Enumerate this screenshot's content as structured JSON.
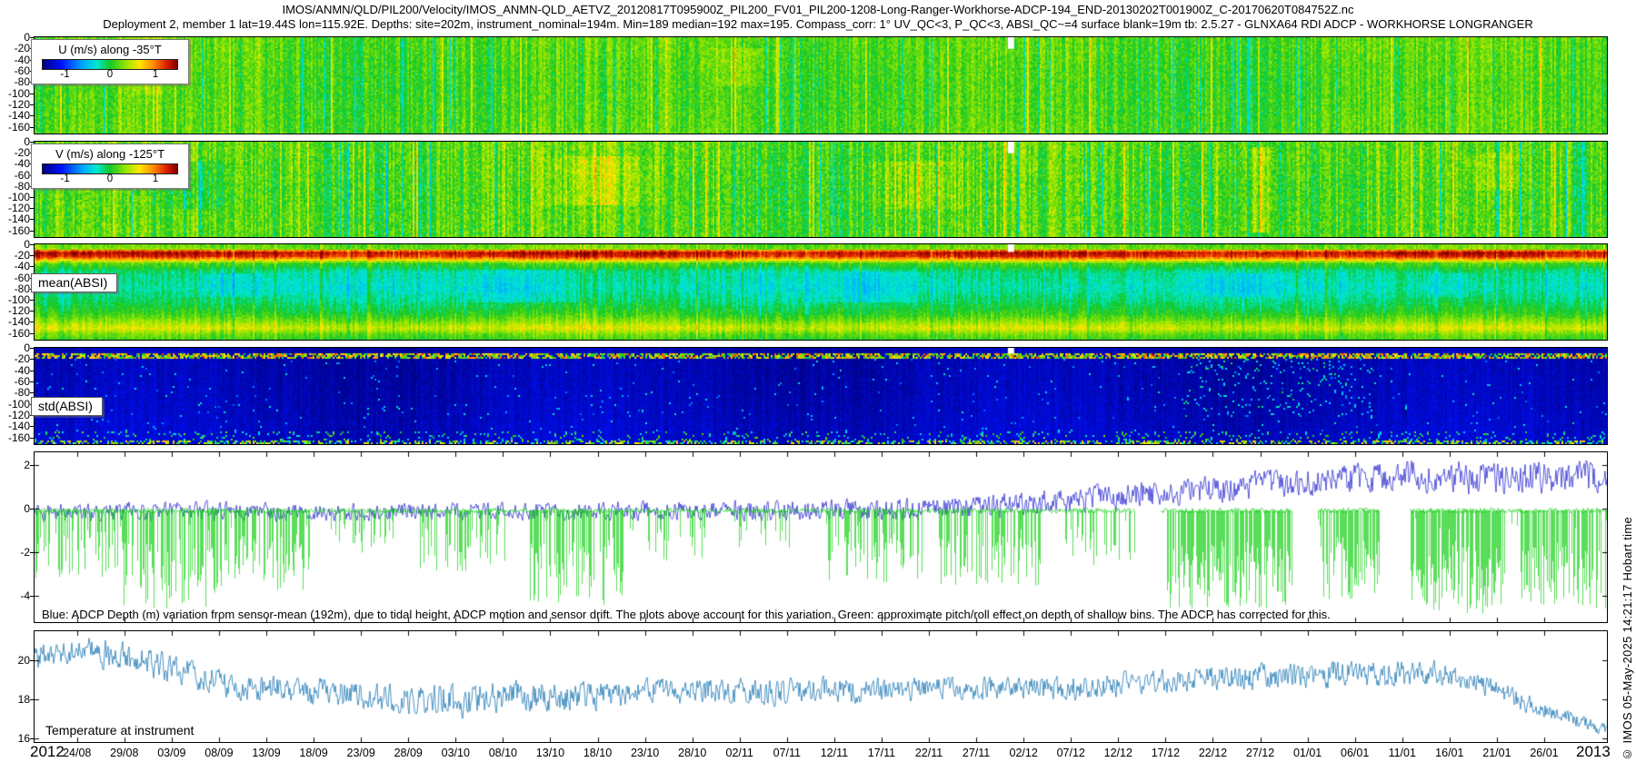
{
  "header": {
    "title_line1": "IMOS/ANMN/QLD/PIL200/Velocity/IMOS_ANMN-QLD_AETVZ_20120817T095900Z_PIL200_FV01_PIL200-1208-Long-Ranger-Workhorse-ADCP-194_END-20130202T001900Z_C-20170620T084752Z.nc",
    "title_line2": "Deployment 2, member 1 lat=19.44S lon=115.92E. Depths: site=202m, instrument_nominal=194m. Min=189 median=192 max=195. Compass_corr: 1° UV_QC<3, P_QC<3, ABSI_QC~=4 surface blank=19m tb: 2.5.27 - GLNXA64 RDI ADCP - WORKHORSE LONGRANGER"
  },
  "watermark": "© IMOS 05-May-2025 14:21:17 Hobart time",
  "x_axis": {
    "year_start": "2012",
    "year_end": "2013",
    "first_tick_frac": 0.027,
    "tick_step_frac": 0.0301,
    "ticks": [
      "24/08",
      "29/08",
      "03/09",
      "08/09",
      "13/09",
      "18/09",
      "23/09",
      "28/09",
      "03/10",
      "08/10",
      "13/10",
      "18/10",
      "23/10",
      "28/10",
      "02/11",
      "07/11",
      "12/11",
      "17/11",
      "22/11",
      "27/11",
      "02/12",
      "07/12",
      "12/12",
      "17/12",
      "22/12",
      "27/12",
      "01/01",
      "06/01",
      "11/01",
      "16/01",
      "21/01",
      "26/01"
    ]
  },
  "chart_data": [
    {
      "id": "u_velocity",
      "type": "heatmap",
      "label": "U (m/s) along -35°T",
      "colorbar": {
        "tick_labels": [
          "-1",
          "0",
          "1"
        ],
        "range": [
          -1.5,
          1.5
        ],
        "colormap": "jet"
      },
      "y_ticks": [
        0,
        -20,
        -40,
        -60,
        -80,
        -100,
        -120,
        -140,
        -160
      ],
      "ylim": [
        -172,
        0
      ],
      "render": {
        "base": 0.545,
        "col_noise": 0.05,
        "row_noise": 0.05,
        "profile": [
          [
            0,
            0.02
          ],
          [
            0.5,
            0
          ],
          [
            1,
            0.015
          ]
        ],
        "stripes": {
          "p_hi": 0.05,
          "hi": 0.1,
          "p_lo": 0.08,
          "lo": -0.09
        },
        "blobs": [
          {
            "x": 0.45,
            "w": 0.03,
            "d0": 0.1,
            "d1": 0.5,
            "delta": 0.05
          },
          {
            "x": 0.07,
            "w": 0.02,
            "d0": 0.0,
            "d1": 0.6,
            "delta": 0.05
          }
        ],
        "gaps": [
          {
            "x": 0.621,
            "w": 0.004,
            "d1": 0.12
          }
        ]
      }
    },
    {
      "id": "v_velocity",
      "type": "heatmap",
      "label": "V (m/s) along -125°T",
      "colorbar": {
        "tick_labels": [
          "-1",
          "0",
          "1"
        ],
        "range": [
          -1.5,
          1.5
        ],
        "colormap": "jet"
      },
      "y_ticks": [
        0,
        -20,
        -40,
        -60,
        -80,
        -100,
        -120,
        -140,
        -160
      ],
      "ylim": [
        -172,
        0
      ],
      "render": {
        "base": 0.545,
        "col_noise": 0.06,
        "row_noise": 0.06,
        "profile": [
          [
            0,
            0.02
          ],
          [
            0.5,
            0
          ],
          [
            1,
            0.01
          ]
        ],
        "stripes": {
          "p_hi": 0.06,
          "hi": 0.12,
          "p_lo": 0.08,
          "lo": -0.1
        },
        "blobs": [
          {
            "x": 0.36,
            "w": 0.05,
            "d0": 0.15,
            "d1": 0.65,
            "delta": 0.09
          },
          {
            "x": 0.56,
            "w": 0.045,
            "d0": 0.2,
            "d1": 0.7,
            "delta": 0.07
          },
          {
            "x": 0.779,
            "w": 0.01,
            "d0": 0.05,
            "d1": 0.95,
            "delta": 0.16
          },
          {
            "x": 0.93,
            "w": 0.03,
            "d0": 0.1,
            "d1": 0.5,
            "delta": 0.06
          },
          {
            "x": 0.1,
            "w": 0.03,
            "d0": 0.2,
            "d1": 0.7,
            "delta": -0.06
          }
        ],
        "gaps": [
          {
            "x": 0.621,
            "w": 0.004,
            "d1": 0.12
          }
        ]
      }
    },
    {
      "id": "mean_absi",
      "type": "heatmap",
      "label": "mean(ABSI)",
      "y_ticks": [
        0,
        -20,
        -40,
        -60,
        -80,
        -100,
        -120,
        -140,
        -160
      ],
      "ylim": [
        -172,
        0
      ],
      "render": {
        "base": 0,
        "absolute_profile": true,
        "col_noise": 0.035,
        "row_noise": 0.035,
        "profile": [
          [
            0,
            0.57
          ],
          [
            0.04,
            0.6
          ],
          [
            0.065,
            0.95
          ],
          [
            0.11,
            0.93
          ],
          [
            0.14,
            0.82
          ],
          [
            0.19,
            0.55
          ],
          [
            0.28,
            0.44
          ],
          [
            0.45,
            0.41
          ],
          [
            0.6,
            0.46
          ],
          [
            0.72,
            0.52
          ],
          [
            0.8,
            0.6
          ],
          [
            0.87,
            0.68
          ],
          [
            0.93,
            0.58
          ],
          [
            1,
            0.52
          ]
        ],
        "stripes": {
          "p_hi": 0.06,
          "hi": 0.05,
          "p_lo": 0.06,
          "lo": -0.05
        },
        "blobs": [
          {
            "x": 0.31,
            "w": 0.05,
            "d0": 0.25,
            "d1": 0.6,
            "delta": -0.07
          },
          {
            "x": 0.53,
            "w": 0.045,
            "d0": 0.28,
            "d1": 0.6,
            "delta": -0.06
          },
          {
            "x": 0.77,
            "w": 0.04,
            "d0": 0.3,
            "d1": 0.55,
            "delta": -0.05
          },
          {
            "x": 0.13,
            "w": 0.035,
            "d0": 0.3,
            "d1": 0.55,
            "delta": -0.05
          },
          {
            "x": 0.9,
            "w": 0.03,
            "d0": 0.3,
            "d1": 0.55,
            "delta": -0.04
          }
        ],
        "gaps": [
          {
            "x": 0.621,
            "w": 0.004,
            "d1": 0.08
          }
        ]
      }
    },
    {
      "id": "std_absi",
      "type": "heatmap",
      "label": "std(ABSI)",
      "y_ticks": [
        0,
        -20,
        -40,
        -60,
        -80,
        -100,
        -120,
        -140,
        -160
      ],
      "ylim": [
        -172,
        0
      ],
      "render": {
        "base": 0.05,
        "col_noise": 0.02,
        "row_noise": 0.025,
        "profile": [
          [
            0,
            0
          ],
          [
            0.5,
            0.01
          ],
          [
            1,
            0.03
          ]
        ],
        "speckle": [
          {
            "d0": 0.04,
            "d1": 0.105,
            "prob": 0.7,
            "tmin": 0.45,
            "tmax": 0.9
          },
          {
            "d0": 0.105,
            "d1": 0.85,
            "prob": 0.012,
            "tmin": 0.22,
            "tmax": 0.42
          },
          {
            "d0": 0.105,
            "d1": 0.7,
            "x0": 0.73,
            "x1": 0.85,
            "prob": 0.06,
            "tmin": 0.25,
            "tmax": 0.48
          },
          {
            "d0": 0.85,
            "d1": 0.96,
            "prob": 0.1,
            "tmin": 0.3,
            "tmax": 0.6
          },
          {
            "d0": 0.96,
            "d1": 1,
            "prob": 0.45,
            "tmin": 0.35,
            "tmax": 0.8
          }
        ],
        "gaps": [
          {
            "x": 0.621,
            "w": 0.004,
            "d1": 0.06
          }
        ]
      }
    },
    {
      "id": "depth_variation",
      "type": "line",
      "ylim": [
        -5.2,
        2.6
      ],
      "y_ticks": [
        2,
        0,
        -2,
        -4
      ],
      "annotation": "Blue: ADCP Depth (m) variation from sensor-mean (192m), due to tidal height, ADCP motion and sensor drift. The plots above account for this variation. Green: approximate pitch/roll effect on depth of shallow bins. The ADCP has corrected for this.",
      "series": [
        {
          "name": "ADCP depth variation",
          "color": "#1414cc",
          "kind": "noisy",
          "width": 0.7,
          "points": [
            [
              0,
              -0.15,
              0.5
            ],
            [
              0.1,
              -0.1,
              0.55
            ],
            [
              0.2,
              -0.15,
              0.5
            ],
            [
              0.3,
              -0.1,
              0.5
            ],
            [
              0.4,
              -0.1,
              0.55
            ],
            [
              0.5,
              -0.05,
              0.6
            ],
            [
              0.58,
              0,
              0.65
            ],
            [
              0.64,
              0.3,
              0.7
            ],
            [
              0.7,
              0.6,
              0.75
            ],
            [
              0.76,
              1,
              0.8
            ],
            [
              0.82,
              1.3,
              0.85
            ],
            [
              0.88,
              1.5,
              0.9
            ],
            [
              0.93,
              1.4,
              0.95
            ],
            [
              1,
              1.6,
              1
            ]
          ]
        },
        {
          "name": "pitch/roll effect on shallow bins",
          "color": "#12cf12",
          "kind": "spikes",
          "width": 0.7,
          "base": -0.08,
          "base_noise": 0.12,
          "bg_density": 0.05,
          "bg_depth": -1.0,
          "clusters": [
            [
              0,
              0.055,
              -3.2,
              0.45
            ],
            [
              0.055,
              0.115,
              -4.6,
              0.65
            ],
            [
              0.115,
              0.175,
              -3.8,
              0.55
            ],
            [
              0.19,
              0.23,
              -2.2,
              0.25
            ],
            [
              0.245,
              0.3,
              -3,
              0.4
            ],
            [
              0.315,
              0.375,
              -4.4,
              0.6
            ],
            [
              0.39,
              0.43,
              -2.4,
              0.3
            ],
            [
              0.445,
              0.48,
              -1.8,
              0.2
            ],
            [
              0.5,
              0.565,
              -3.4,
              0.45
            ],
            [
              0.575,
              0.64,
              -3.6,
              0.5
            ],
            [
              0.655,
              0.7,
              -2.6,
              0.35
            ],
            [
              0.72,
              0.8,
              -4.6,
              0.75
            ],
            [
              0.816,
              0.855,
              -4.2,
              0.7
            ],
            [
              0.875,
              0.935,
              -4.8,
              0.8
            ],
            [
              0.945,
              1,
              -4.6,
              0.75
            ]
          ],
          "gaps": [
            [
              0.7,
              0.716
            ],
            [
              0.8,
              0.816
            ],
            [
              0.855,
              0.875
            ]
          ]
        }
      ]
    },
    {
      "id": "temperature",
      "type": "line",
      "label": "Temperature at instrument",
      "ylim": [
        15.8,
        21.5
      ],
      "y_ticks": [
        20,
        18,
        16
      ],
      "series": [
        {
          "name": "Temperature at instrument",
          "color": "#1f78b4",
          "kind": "noisy",
          "width": 0.8,
          "points": [
            [
              0,
              20.2,
              0.9
            ],
            [
              0.02,
              20.5,
              0.8
            ],
            [
              0.05,
              20.3,
              1
            ],
            [
              0.09,
              19.5,
              0.9
            ],
            [
              0.13,
              18.6,
              0.8
            ],
            [
              0.17,
              18.4,
              0.9
            ],
            [
              0.21,
              18.2,
              0.9
            ],
            [
              0.24,
              18,
              1
            ],
            [
              0.27,
              17.9,
              1.1
            ],
            [
              0.3,
              18.2,
              1
            ],
            [
              0.34,
              18.1,
              0.9
            ],
            [
              0.38,
              18.3,
              0.9
            ],
            [
              0.42,
              18.5,
              0.8
            ],
            [
              0.46,
              18.3,
              0.9
            ],
            [
              0.5,
              18.5,
              0.8
            ],
            [
              0.54,
              18.4,
              0.8
            ],
            [
              0.58,
              18.6,
              0.7
            ],
            [
              0.62,
              18.5,
              0.8
            ],
            [
              0.66,
              18.6,
              0.8
            ],
            [
              0.7,
              18.8,
              0.8
            ],
            [
              0.74,
              19,
              0.8
            ],
            [
              0.78,
              19.1,
              0.9
            ],
            [
              0.82,
              19.3,
              0.9
            ],
            [
              0.86,
              19.2,
              0.9
            ],
            [
              0.89,
              19.4,
              0.8
            ],
            [
              0.92,
              18.8,
              0.7
            ],
            [
              0.95,
              17.8,
              0.6
            ],
            [
              0.97,
              17.2,
              0.5
            ],
            [
              1,
              16.4,
              0.4
            ]
          ]
        }
      ]
    }
  ]
}
